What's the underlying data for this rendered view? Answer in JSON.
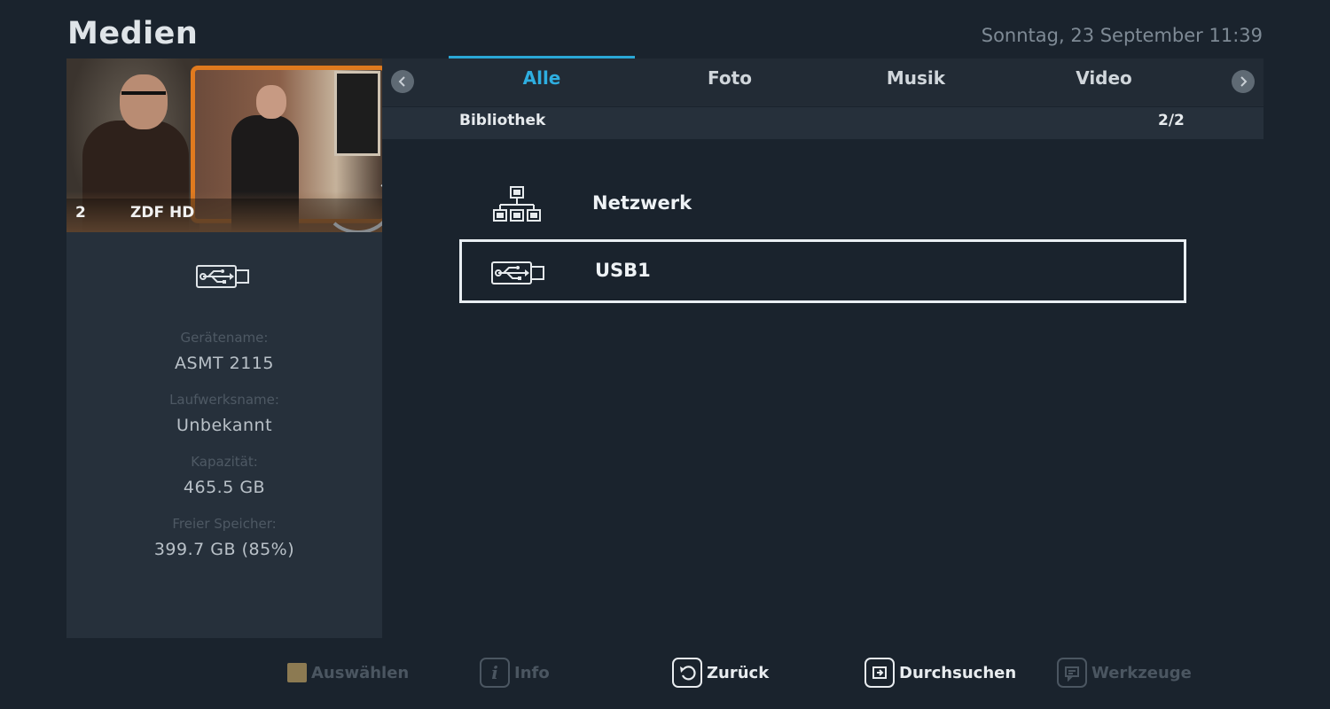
{
  "header": {
    "title": "Medien",
    "datetime": "Sonntag, 23 September 11:39"
  },
  "preview": {
    "channel_number": "2",
    "channel_name": "ZDF HD"
  },
  "device_info": {
    "icon": "usb-icon",
    "fields": [
      {
        "label": "Gerätename:",
        "value": "ASMT 2115"
      },
      {
        "label": "Laufwerksname:",
        "value": "Unbekannt"
      },
      {
        "label": "Kapazität:",
        "value": "465.5 GB"
      },
      {
        "label": "Freier Speicher:",
        "value": "399.7 GB (85%)"
      }
    ]
  },
  "tabs": [
    {
      "label": "Alle",
      "active": true
    },
    {
      "label": "Foto",
      "active": false
    },
    {
      "label": "Musik",
      "active": false
    },
    {
      "label": "Video",
      "active": false
    }
  ],
  "library": {
    "label": "Bibliothek",
    "page": "2/2"
  },
  "items": [
    {
      "label": "Netzwerk",
      "icon": "network-icon",
      "selected": false
    },
    {
      "label": "USB1",
      "icon": "usb-icon",
      "selected": true
    }
  ],
  "footer": [
    {
      "label": "Auswählen",
      "icon": "yellow-key-icon",
      "enabled": false
    },
    {
      "label": "Info",
      "icon": "info-icon",
      "enabled": false
    },
    {
      "label": "Zurück",
      "icon": "back-icon",
      "enabled": true
    },
    {
      "label": "Durchsuchen",
      "icon": "browse-icon",
      "enabled": true
    },
    {
      "label": "Werkzeuge",
      "icon": "tools-icon",
      "enabled": false
    }
  ],
  "colors": {
    "background": "#1a232d",
    "panel": "#26303b",
    "accent": "#2eaee0",
    "preview_frame": "#e07a1e"
  }
}
